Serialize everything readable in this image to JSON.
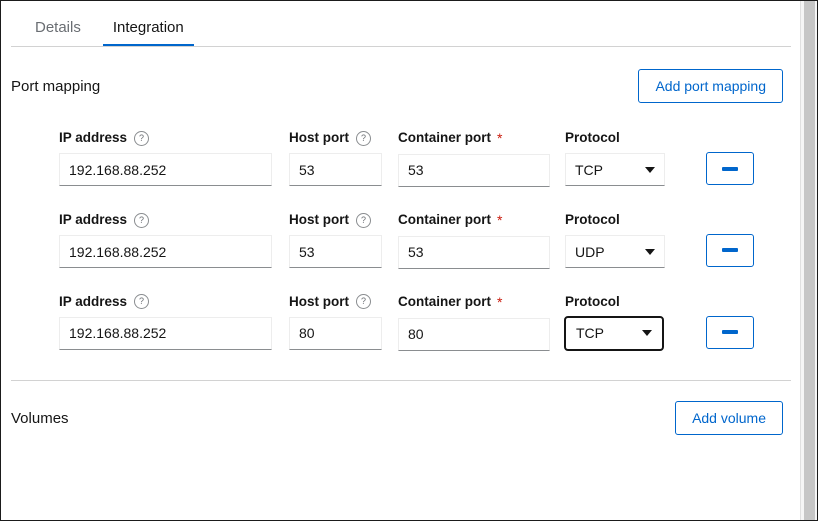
{
  "window": {
    "accent_color": "#0066cc",
    "required_color": "#c9190b",
    "text_color": "#151515",
    "muted_color": "#6a6e73"
  },
  "tabs": [
    {
      "label": "Details",
      "active": false
    },
    {
      "label": "Integration",
      "active": true
    }
  ],
  "port_mapping": {
    "title": "Port mapping",
    "add_button": "Add port mapping",
    "columns": {
      "ip_address": "IP address",
      "host_port": "Host port",
      "container_port": "Container port",
      "protocol": "Protocol"
    },
    "required_marker": "*",
    "help_glyph": "?",
    "rows": [
      {
        "ip_address": "192.168.88.252",
        "host_port": "53",
        "container_port": "53",
        "protocol": "TCP",
        "protocol_focused": false,
        "remove_label": "−"
      },
      {
        "ip_address": "192.168.88.252",
        "host_port": "53",
        "container_port": "53",
        "protocol": "UDP",
        "protocol_focused": false,
        "remove_label": "−"
      },
      {
        "ip_address": "192.168.88.252",
        "host_port": "80",
        "container_port": "80",
        "protocol": "TCP",
        "protocol_focused": true,
        "remove_label": "−"
      }
    ],
    "protocol_options": [
      "TCP",
      "UDP"
    ]
  },
  "volumes": {
    "title": "Volumes",
    "add_button": "Add volume"
  }
}
